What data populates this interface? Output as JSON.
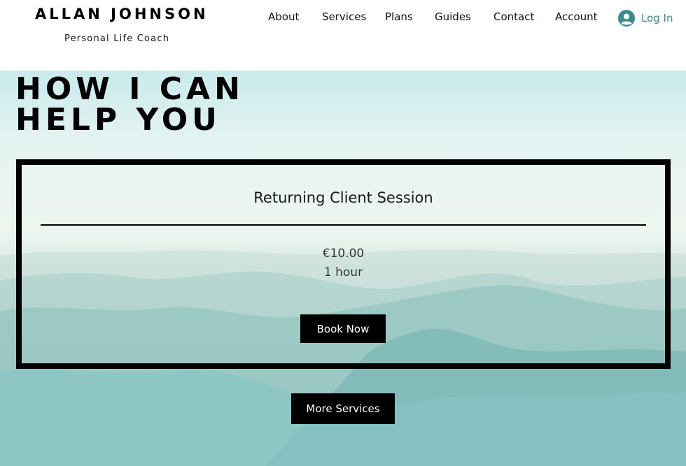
{
  "header": {
    "brand_name": "ALLAN JOHNSON",
    "tagline": "Personal Life Coach",
    "nav_items": [
      "About",
      "Services",
      "Plans",
      "Guides",
      "Contact",
      "Account"
    ],
    "login_label": "Log In",
    "login_icon": "user-avatar-icon",
    "login_color": "#3a8a8e"
  },
  "hero": {
    "title_line1": "HOW I CAN",
    "title_line2": "HELP YOU"
  },
  "service": {
    "name": "Returning Client Session",
    "price": "€10.00",
    "duration": "1 hour",
    "book_label": "Book Now"
  },
  "more_services_label": "More Services"
}
